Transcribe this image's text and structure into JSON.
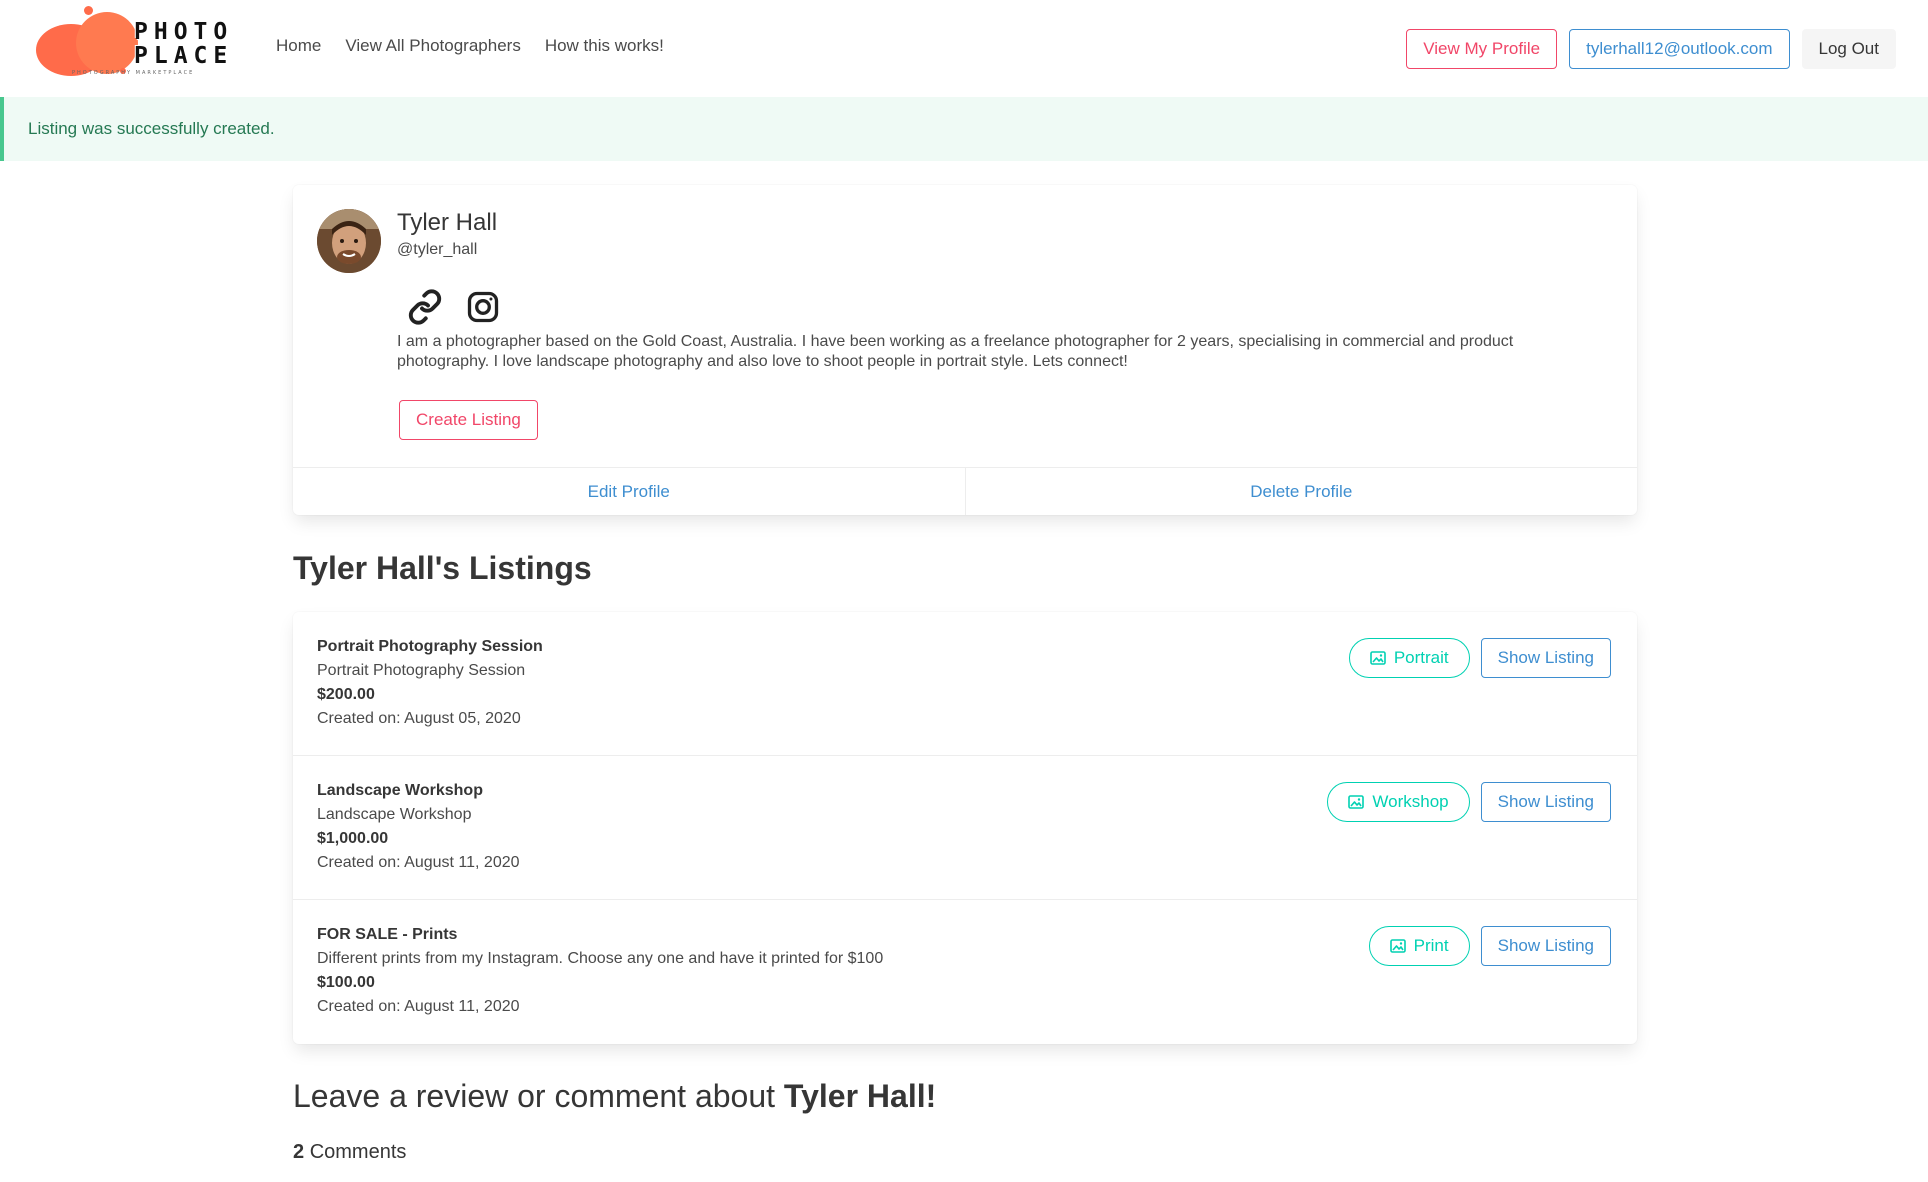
{
  "navbar": {
    "logo_text": "PHOTO PLACE",
    "logo_subtitle": "PHOTOGRAPHY MARKETPLACE",
    "links": [
      "Home",
      "View All Photographers",
      "How this works!"
    ],
    "view_profile": "View My Profile",
    "user_email": "tylerhall12@outlook.com",
    "logout": "Log Out"
  },
  "notification": "Listing was successfully created.",
  "profile": {
    "name": "Tyler Hall",
    "handle": "@tyler_hall",
    "bio": "I am a photographer based on the Gold Coast, Australia. I have been working as a freelance photographer for 2 years, specialising in commercial and product photography. I love landscape photography and also love to shoot people in portrait style. Lets connect!",
    "create_listing": "Create Listing",
    "edit_profile": "Edit Profile",
    "delete_profile": "Delete Profile"
  },
  "listings_title": "Tyler Hall's Listings",
  "listings": [
    {
      "title": "Portrait Photography Session",
      "description": "Portrait Photography Session",
      "price": "$200.00",
      "created": "Created on: August 05, 2020",
      "category": "Portrait",
      "show": "Show Listing"
    },
    {
      "title": "Landscape Workshop",
      "description": "Landscape Workshop",
      "price": "$1,000.00",
      "created": "Created on: August 11, 2020",
      "category": "Workshop",
      "show": "Show Listing"
    },
    {
      "title": "FOR SALE - Prints",
      "description": "Different prints from my Instagram. Choose any one and have it printed for $100",
      "price": "$100.00",
      "created": "Created on: August 11, 2020",
      "category": "Print",
      "show": "Show Listing"
    }
  ],
  "review": {
    "prefix": "Leave a review or comment about",
    "name": "Tyler Hall!",
    "comment_count": "2",
    "comments_label": "Comments"
  },
  "colors": {
    "primary_pink": "#f14668",
    "info_blue": "#3e8ed0",
    "teal": "#00d1b2",
    "success_bg": "#effaf5",
    "success_text": "#257953"
  }
}
